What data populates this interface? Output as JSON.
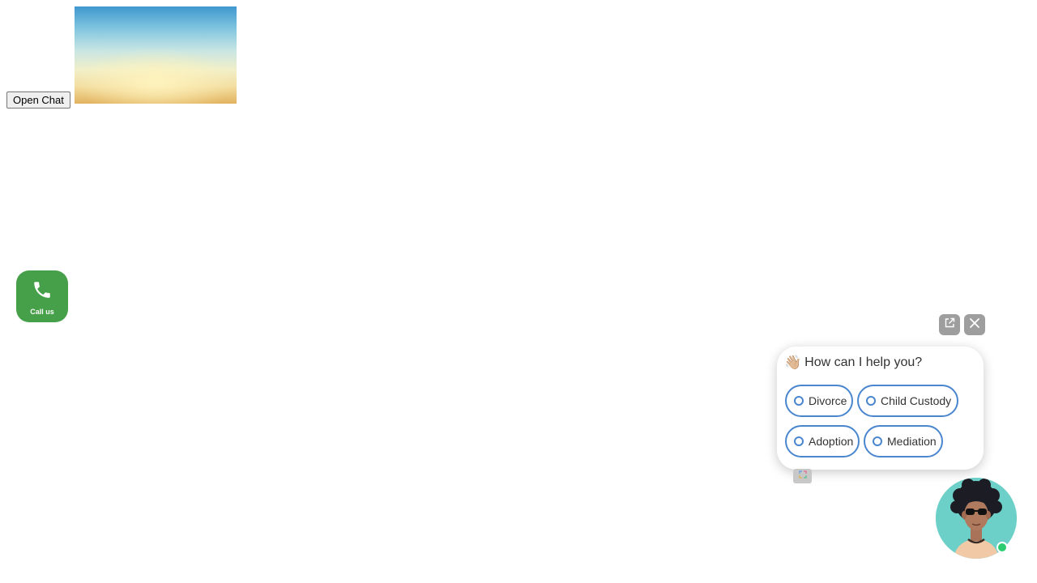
{
  "open_chat": {
    "label": "Open Chat"
  },
  "call_us": {
    "label": "Call us",
    "icon": "phone-icon",
    "color": "#46a049"
  },
  "widget": {
    "popout_icon": "external-link-icon",
    "close_icon": "close-icon",
    "greeting_emoji": "👋🏼",
    "greeting": "How can I help you?",
    "options": [
      {
        "label": "Divorce"
      },
      {
        "label": "Child Custody"
      },
      {
        "label": "Adoption"
      },
      {
        "label": "Mediation"
      }
    ],
    "accent_color": "#4a86cf",
    "status": "online",
    "status_color": "#2ecc71"
  }
}
